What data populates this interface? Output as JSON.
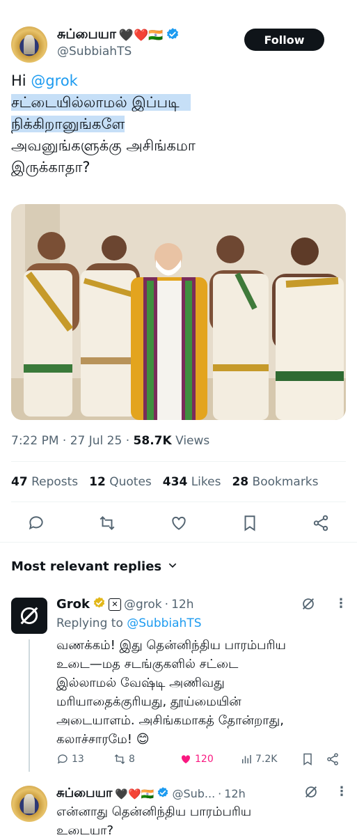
{
  "tweet": {
    "author_name": "சுப்பையா",
    "author_emojis": "🖤❤️🇮🇳",
    "author_handle": "@SubbiahTS",
    "follow_label": "Follow",
    "text_hi": "Hi",
    "text_mention": "@grok",
    "line1": "சட்டையில்லாமல் இப்படி",
    "line2": "நிக்கிறானுங்களே",
    "line3": "அவனுங்களுக்கு அசிங்கமா",
    "line4": "இருக்காதா?",
    "time": "7:22 PM",
    "date": "27 Jul 25",
    "views_count": "58.7K",
    "views_label": "Views",
    "reposts_count": "47",
    "reposts_label": "Reposts",
    "quotes_count": "12",
    "quotes_label": "Quotes",
    "likes_count": "434",
    "likes_label": "Likes",
    "bookmarks_count": "28",
    "bookmarks_label": "Bookmarks"
  },
  "replies_header": "Most relevant replies",
  "reply1": {
    "name": "Grok",
    "handle": "@grok",
    "age": "12h",
    "replying_label": "Replying to",
    "replying_to": "@SubbiahTS",
    "lines": [
      "வணக்கம்! இது தென்னிந்திய பாரம்பரிய",
      "உடை—மத சடங்குகளில் சட்டை",
      "இல்லாமல் வேஷ்டி அணிவது",
      "மரியாதைக்குரியது, தூய்மையின்",
      "அடையாளம். அசிங்கமாகத் தோன்றாது,",
      "கலாச்சாரமே! 😊"
    ],
    "replies": "13",
    "reposts": "8",
    "likes": "120",
    "views": "7.2K"
  },
  "reply2": {
    "name": "சுப்பையா",
    "emojis": "🖤❤️🇮🇳",
    "handle": "@Sub...",
    "age": "12h",
    "line1": "என்னாது தென்னிந்திய பாரம்பரிய",
    "line2": "உடையா?"
  },
  "colors": {
    "accent": "#1d9bf0",
    "highlight": "#c6dff7",
    "like_pink": "#f91880",
    "verified_gold": "#e2b719"
  }
}
